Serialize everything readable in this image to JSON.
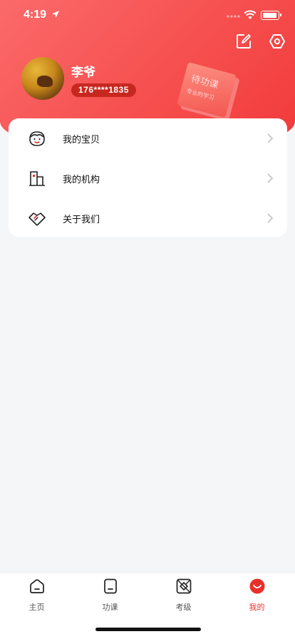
{
  "status_bar": {
    "time": "4:19"
  },
  "profile": {
    "name": "李爷",
    "phone": "176****1835",
    "book_title": "待功课",
    "book_subtitle": "专业的学习"
  },
  "menu": {
    "items": [
      {
        "label": "我的宝贝",
        "icon": "baby-face-icon"
      },
      {
        "label": "我的机构",
        "icon": "building-icon"
      },
      {
        "label": "关于我们",
        "icon": "handshake-icon"
      }
    ]
  },
  "tabbar": {
    "tabs": [
      {
        "label": "主页",
        "icon": "home-icon",
        "active": false
      },
      {
        "label": "功课",
        "icon": "homework-icon",
        "active": false
      },
      {
        "label": "考级",
        "icon": "exam-icon",
        "active": false
      },
      {
        "label": "我的",
        "icon": "profile-icon",
        "active": true
      }
    ]
  },
  "colors": {
    "accent": "#e8302a",
    "header_start": "#fb6a6a",
    "header_end": "#f23a3a",
    "badge": "#c7271f",
    "background": "#f5f6f8"
  }
}
